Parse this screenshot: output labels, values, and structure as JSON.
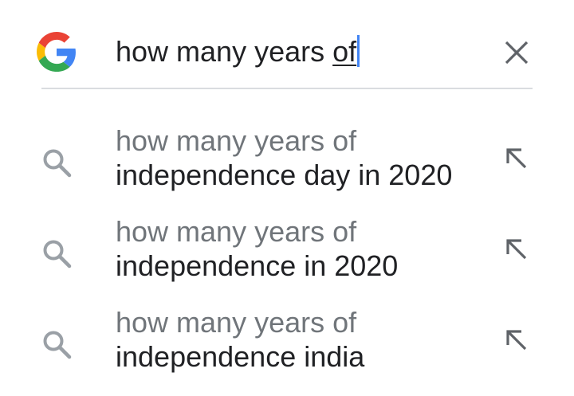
{
  "search": {
    "query_prefix": "how many years ",
    "query_typed": "of"
  },
  "suggestions": [
    {
      "prefix": "how many years of",
      "completion": "independence day in 2020"
    },
    {
      "prefix": "how many years of",
      "completion": "independence in 2020"
    },
    {
      "prefix": "how many years of",
      "completion": "independence india"
    }
  ],
  "icons": {
    "logo": "google-g-logo-icon",
    "clear": "close-icon",
    "suggestion": "search-icon",
    "refine": "arrow-up-left-icon"
  },
  "colors": {
    "g_blue": "#4285f4",
    "g_red": "#ea4335",
    "g_yellow": "#fbbc05",
    "g_green": "#34a853",
    "text_primary": "#202124",
    "text_secondary": "#70757a",
    "icon_gray": "#9aa0a6",
    "divider": "#dadce0"
  }
}
